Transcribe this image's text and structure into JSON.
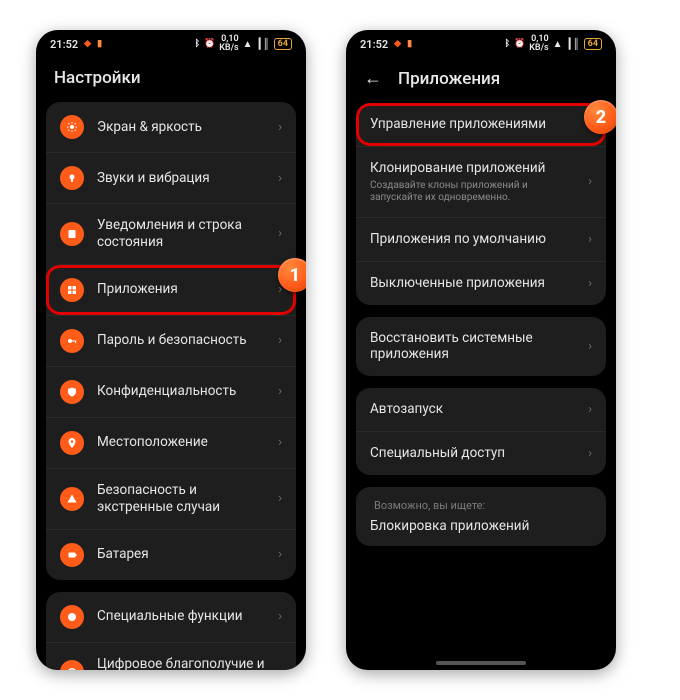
{
  "status": {
    "time": "21:52",
    "net": "0,10",
    "netUnit": "KB/s",
    "battery": "64"
  },
  "left": {
    "title": "Настройки",
    "marker": "1",
    "items": [
      {
        "icon": "brightness",
        "label": "Экран & яркость"
      },
      {
        "icon": "sound",
        "label": "Звуки и вибрация"
      },
      {
        "icon": "notif",
        "label": "Уведомления и строка состояния"
      },
      {
        "icon": "apps",
        "label": "Приложения",
        "hl": true
      },
      {
        "icon": "key",
        "label": "Пароль и безопасность"
      },
      {
        "icon": "privacy",
        "label": "Конфиденциальность"
      },
      {
        "icon": "location",
        "label": "Местоположение"
      },
      {
        "icon": "sos",
        "label": "Безопасность и экстренные случаи"
      },
      {
        "icon": "battery",
        "label": "Батарея"
      },
      {
        "icon": "special",
        "label": "Специальные функции"
      },
      {
        "icon": "wellbeing",
        "label": "Цифровое благополучие и родительский контроль"
      }
    ]
  },
  "right": {
    "title": "Приложения",
    "marker": "2",
    "groups": [
      [
        {
          "label": "Управление приложениями",
          "hl": true
        },
        {
          "label": "Клонирование приложений",
          "sub": "Создавайте клоны приложений и запускайте их одновременно."
        },
        {
          "label": "Приложения по умолчанию"
        },
        {
          "label": "Выключенные приложения"
        }
      ],
      [
        {
          "label": "Восстановить системные приложения"
        }
      ],
      [
        {
          "label": "Автозапуск"
        },
        {
          "label": "Специальный доступ"
        }
      ]
    ],
    "hint": "Возможно, вы ищете:",
    "suggest": "Блокировка приложений"
  }
}
